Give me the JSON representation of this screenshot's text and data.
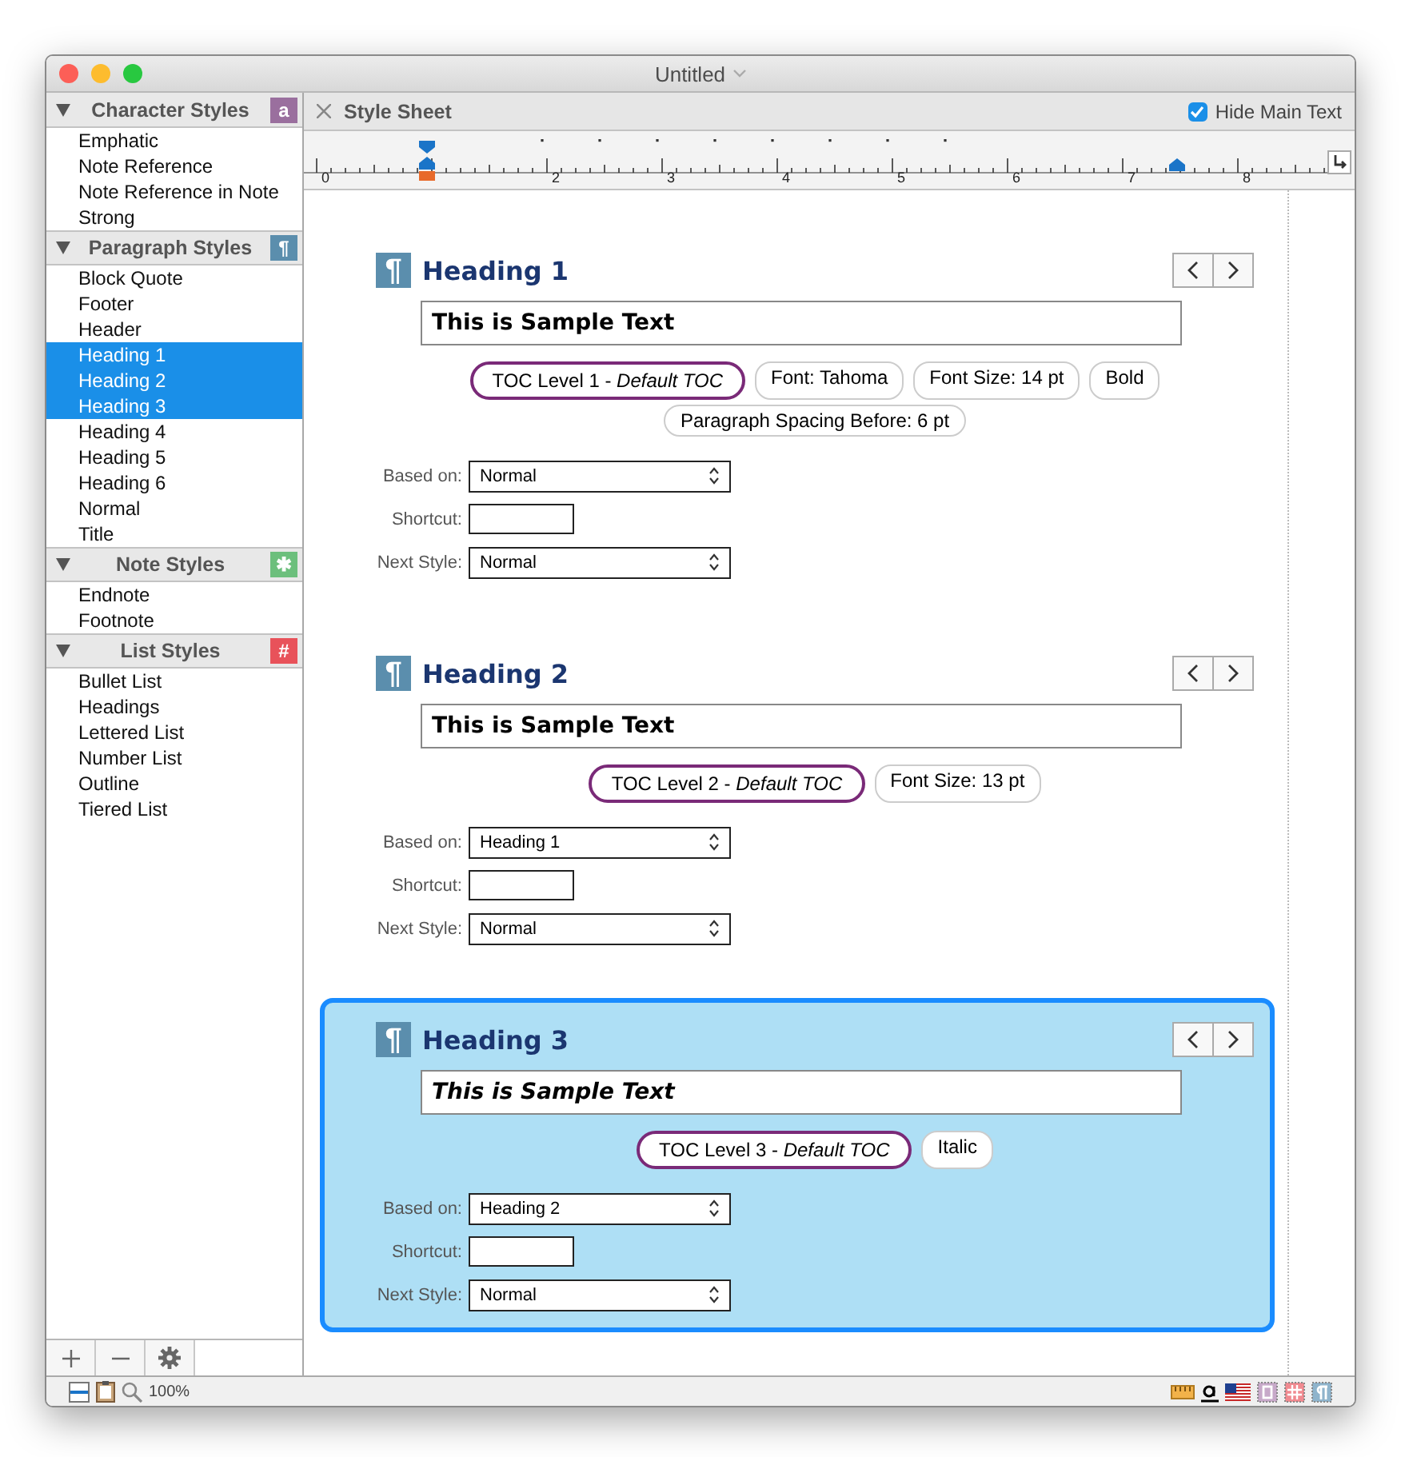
{
  "window": {
    "title": "Untitled"
  },
  "sidebar": {
    "sections": [
      {
        "title": "Character Styles",
        "badge": "a",
        "color": "#9a6f9e",
        "expanded": true,
        "items": [
          {
            "label": "Emphatic",
            "selected": false
          },
          {
            "label": "Note Reference",
            "selected": false
          },
          {
            "label": "Note Reference in Note",
            "selected": false
          },
          {
            "label": "Strong",
            "selected": false
          }
        ]
      },
      {
        "title": "Paragraph Styles",
        "badge": "¶",
        "color": "#5b8ead",
        "expanded": true,
        "items": [
          {
            "label": "Block Quote",
            "selected": false
          },
          {
            "label": "Footer",
            "selected": false
          },
          {
            "label": "Header",
            "selected": false
          },
          {
            "label": "Heading 1",
            "selected": true
          },
          {
            "label": "Heading 2",
            "selected": true
          },
          {
            "label": "Heading 3",
            "selected": true
          },
          {
            "label": "Heading 4",
            "selected": false
          },
          {
            "label": "Heading 5",
            "selected": false
          },
          {
            "label": "Heading 6",
            "selected": false
          },
          {
            "label": "Normal",
            "selected": false
          },
          {
            "label": "Title",
            "selected": false
          }
        ]
      },
      {
        "title": "Note Styles",
        "badge": "✱",
        "color": "#6cbf7c",
        "expanded": true,
        "items": [
          {
            "label": "Endnote",
            "selected": false
          },
          {
            "label": "Footnote",
            "selected": false
          }
        ]
      },
      {
        "title": "List Styles",
        "badge": "#",
        "color": "#e8525a",
        "expanded": true,
        "items": [
          {
            "label": "Bullet List",
            "selected": false
          },
          {
            "label": "Headings",
            "selected": false
          },
          {
            "label": "Lettered List",
            "selected": false
          },
          {
            "label": "Number List",
            "selected": false
          },
          {
            "label": "Outline",
            "selected": false
          },
          {
            "label": "Tiered List",
            "selected": false
          }
        ]
      }
    ]
  },
  "panel": {
    "title": "Style Sheet",
    "hide_main_text": {
      "label": "Hide Main Text",
      "checked": true
    }
  },
  "ruler": {
    "labels": [
      "0",
      "2",
      "3",
      "4",
      "5",
      "6",
      "7",
      "8"
    ]
  },
  "styles": [
    {
      "icon": "¶",
      "name": "Heading 1",
      "sample": "This is Sample Text",
      "italic": false,
      "selected": false,
      "tags": [
        {
          "text": "TOC Level 1 - *Default TOC*",
          "highlighted": true
        },
        {
          "text": "Font: Tahoma",
          "highlighted": false
        },
        {
          "text": "Font Size: 14 pt",
          "highlighted": false
        },
        {
          "text": "Bold",
          "highlighted": false
        },
        {
          "text": "Paragraph Spacing Before: 6 pt",
          "highlighted": false
        }
      ],
      "fields": [
        {
          "label": "Based on:",
          "kind": "select",
          "value": "Normal"
        },
        {
          "label": "Shortcut:",
          "kind": "text"
        },
        {
          "label": "Next Style:",
          "kind": "select",
          "value": "Normal"
        }
      ]
    },
    {
      "icon": "¶",
      "name": "Heading 2",
      "sample": "This is Sample Text",
      "italic": false,
      "selected": false,
      "tags": [
        {
          "text": "TOC Level 2 - *Default TOC*",
          "highlighted": true
        },
        {
          "text": "Font Size: 13 pt",
          "highlighted": false
        }
      ],
      "fields": [
        {
          "label": "Based on:",
          "kind": "select",
          "value": "Heading 1"
        },
        {
          "label": "Shortcut:",
          "kind": "text"
        },
        {
          "label": "Next Style:",
          "kind": "select",
          "value": "Normal"
        }
      ]
    },
    {
      "icon": "¶",
      "name": "Heading 3",
      "sample": "This is Sample Text",
      "italic": true,
      "selected": true,
      "tags": [
        {
          "text": "TOC Level 3 - *Default TOC*",
          "highlighted": true
        },
        {
          "text": "Italic",
          "highlighted": false
        }
      ],
      "fields": [
        {
          "label": "Based on:",
          "kind": "select",
          "value": "Heading 2"
        },
        {
          "label": "Shortcut:",
          "kind": "text"
        },
        {
          "label": "Next Style:",
          "kind": "select",
          "value": "Normal"
        }
      ]
    }
  ],
  "status_bar": {
    "zoom": "100%"
  }
}
